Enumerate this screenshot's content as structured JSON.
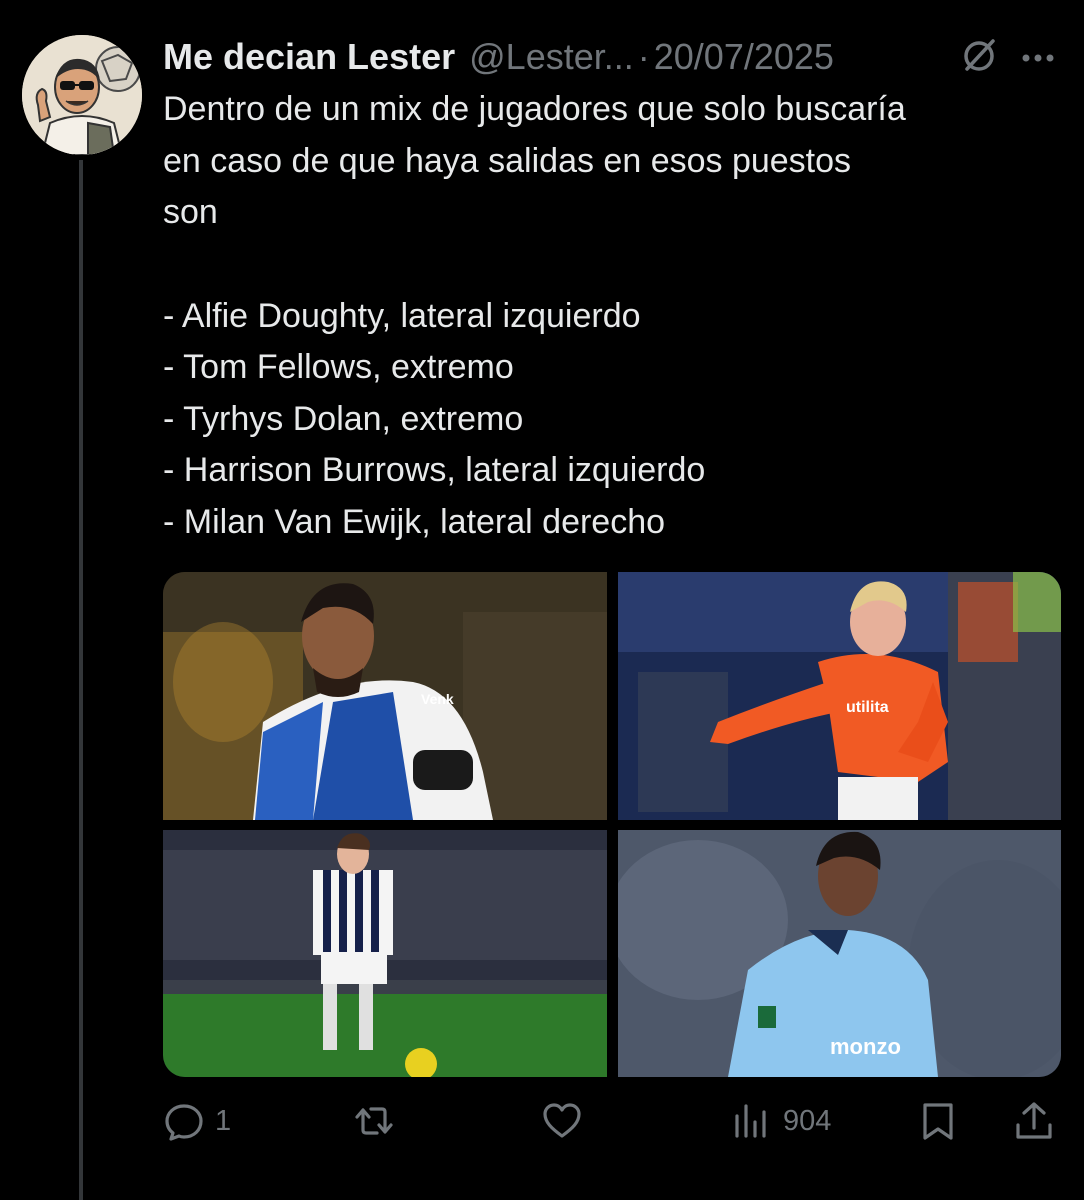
{
  "tweet": {
    "author_name": "Me decian Lester",
    "handle": "@Lester...",
    "separator": "·",
    "date": "20/07/2025",
    "text_lines": [
      "Dentro de un mix de jugadores que solo buscaría",
      "en caso de que haya salidas en esos puestos",
      "son"
    ],
    "list_items": [
      "- Alfie Doughty, lateral izquierdo",
      "- Tom Fellows, extremo",
      "- Tyrhys Dolan, extremo",
      "- Harrison Burrows, lateral izquierdo",
      "- Milan Van Ewijk, lateral derecho"
    ],
    "photo_texts": {
      "photo1_sponsor": "Venk",
      "photo2_sponsor": "utilita",
      "photo4_sponsor": "monzo"
    }
  },
  "actions": {
    "reply_count": "1",
    "retweet_count": "",
    "like_count": "",
    "views_count": "904"
  },
  "colors": {
    "background": "#000000",
    "text_primary": "#e7e9ea",
    "text_secondary": "#71767b",
    "thread_line": "#333639"
  },
  "icons": {
    "grok": "grok-icon",
    "more": "more-dots-icon",
    "reply": "reply-icon",
    "retweet": "retweet-icon",
    "like": "heart-icon",
    "views": "views-icon",
    "bookmark": "bookmark-icon",
    "share": "share-icon"
  }
}
